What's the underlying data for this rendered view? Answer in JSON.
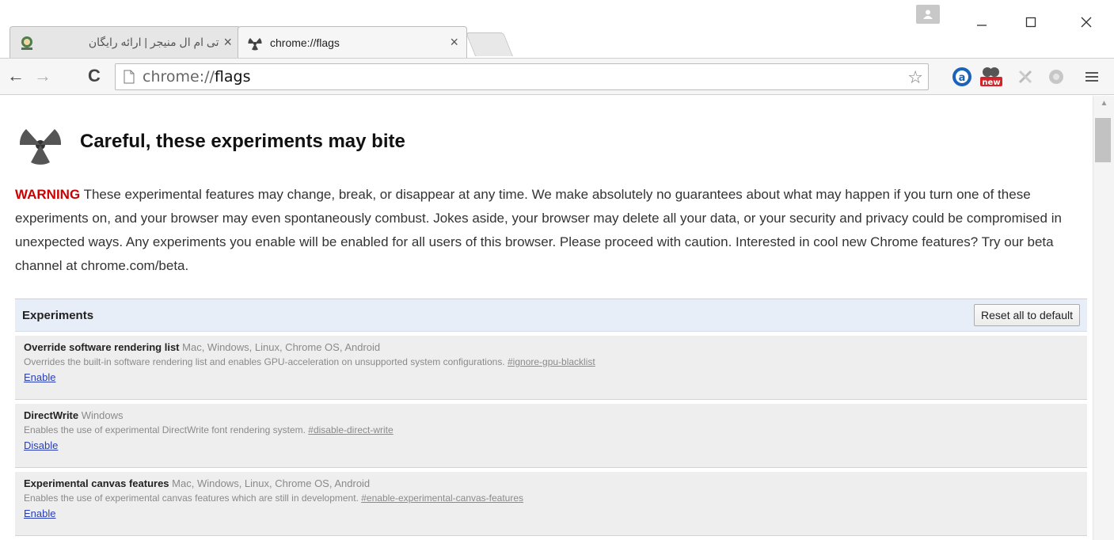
{
  "tabs": [
    {
      "title": "تی ام ال منیجر | ارائه رایگان"
    },
    {
      "title": "chrome://flags"
    }
  ],
  "toolbar": {
    "url_scheme": "chrome://",
    "url_path": "flags"
  },
  "page": {
    "heading": "Careful, these experiments may bite",
    "warning_word": "WARNING",
    "warning_text": " These experimental features may change, break, or disappear at any time. We make absolutely no guarantees about what may happen if you turn one of these experiments on, and your browser may even spontaneously combust. Jokes aside, your browser may delete all your data, or your security and privacy could be compromised in unexpected ways. Any experiments you enable will be enabled for all users of this browser. Please proceed with caution. Interested in cool new Chrome features? Try our beta channel at chrome.com/beta."
  },
  "experiments": {
    "header": "Experiments",
    "reset_label": "Reset all to default",
    "items": [
      {
        "name": "Override software rendering list",
        "platforms": "Mac, Windows, Linux, Chrome OS, Android",
        "description": "Overrides the built-in software rendering list and enables GPU-acceleration on unsupported system configurations.",
        "hash": "#ignore-gpu-blacklist",
        "action": "Enable"
      },
      {
        "name": "DirectWrite",
        "platforms": "Windows",
        "description": "Enables the use of experimental DirectWrite font rendering system.",
        "hash": "#disable-direct-write",
        "action": "Disable"
      },
      {
        "name": "Experimental canvas features",
        "platforms": "Mac, Windows, Linux, Chrome OS, Android",
        "description": "Enables the use of experimental canvas features which are still in development.",
        "hash": "#enable-experimental-canvas-features",
        "action": "Enable"
      }
    ]
  },
  "icons": {
    "tab1_favicon": "avatar-icon",
    "tab2_favicon": "radiation-icon",
    "ext_new_badge": "new"
  }
}
